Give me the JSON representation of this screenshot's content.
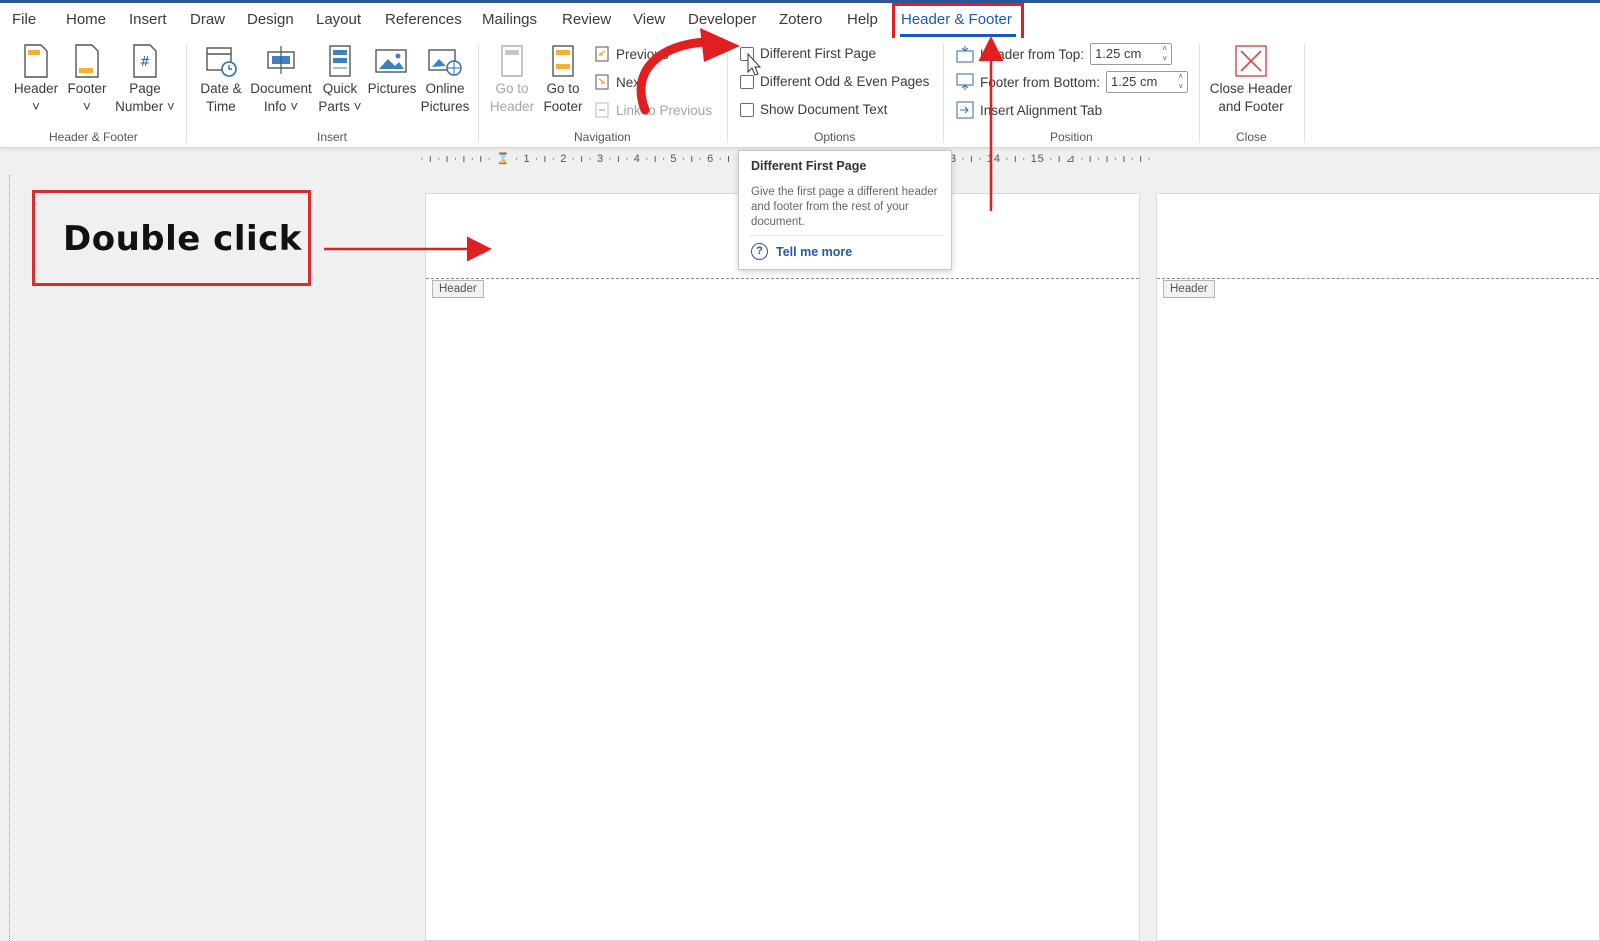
{
  "menu": {
    "tabs": [
      "File",
      "Home",
      "Insert",
      "Draw",
      "Design",
      "Layout",
      "References",
      "Mailings",
      "Review",
      "View",
      "Developer",
      "Zotero",
      "Help"
    ],
    "active_tab": "Header & Footer"
  },
  "ribbon": {
    "header_footer_group": {
      "label": "Header & Footer",
      "header_line1": "Header",
      "header_line2": "˅",
      "footer_line1": "Footer",
      "footer_line2": "˅",
      "page_number_line1": "Page",
      "page_number_line2": "Number ˅"
    },
    "insert_group": {
      "label": "Insert",
      "date_time_line1": "Date &",
      "date_time_line2": "Time",
      "document_info_line1": "Document",
      "document_info_line2": "Info ˅",
      "quick_parts_line1": "Quick",
      "quick_parts_line2": "Parts ˅",
      "pictures": "Pictures",
      "online_pictures_line1": "Online",
      "online_pictures_line2": "Pictures"
    },
    "navigation_group": {
      "label": "Navigation",
      "go_to_header_line1": "Go to",
      "go_to_header_line2": "Header",
      "go_to_footer_line1": "Go to",
      "go_to_footer_line2": "Footer",
      "previous": "Previous",
      "next": "Next",
      "link_to_previous": "Link to Previous"
    },
    "options_group": {
      "label": "Options",
      "different_first_page": "Different First Page",
      "different_odd_even": "Different Odd & Even Pages",
      "show_document_text": "Show Document Text"
    },
    "position_group": {
      "label": "Position",
      "header_from_top_label": "Header from Top:",
      "header_from_top_value": "1.25 cm",
      "footer_from_bottom_label": "Footer from Bottom:",
      "footer_from_bottom_value": "1.25 cm",
      "insert_alignment_tab": "Insert Alignment Tab"
    },
    "close_group": {
      "label": "Close",
      "close_line1": "Close Header",
      "close_line2": "and Footer"
    }
  },
  "ruler": {
    "text": "· ı · ı · ı · ı · ⌛ · 1 · ı · 2 · ı · 3 · ı · 4 · ı · 5 · ı · 6 · ı",
    "right_text": "3 · ı · 14 · ı · 15 · ı ⊿ · ı · ı · ı · ı ·"
  },
  "tooltip": {
    "title": "Different First Page",
    "body": "Give the first page a different header and footer from the rest of your document.",
    "help_label": "Tell me more"
  },
  "pages": {
    "header_tag": "Header"
  },
  "annotation": {
    "callout_text": "Double click",
    "accent_color": "#e02020"
  }
}
